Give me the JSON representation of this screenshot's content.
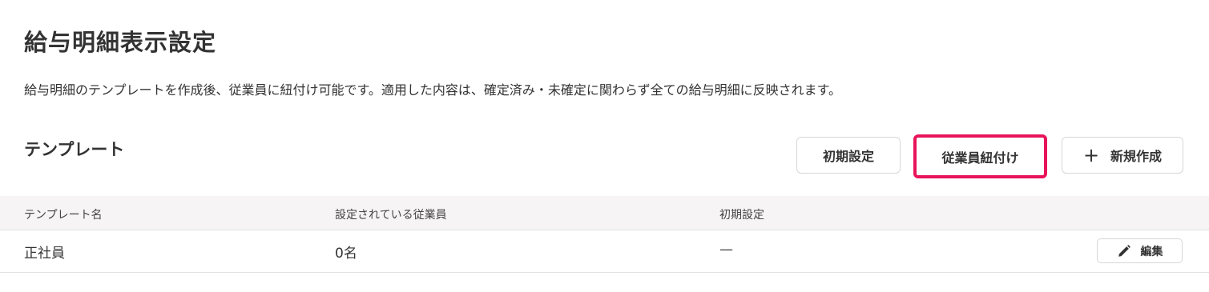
{
  "page": {
    "title": "給与明細表示設定",
    "description": "給与明細のテンプレートを作成後、従業員に紐付け可能です。適用した内容は、確定済み・未確定に関わらず全ての給与明細に反映されます。"
  },
  "section": {
    "title": "テンプレート"
  },
  "toolbar": {
    "initial_settings_label": "初期設定",
    "link_employees_label": "従業員紐付け",
    "new_create_label": "新規作成",
    "plus_glyph": "+",
    "highlight_color": "#e8145a"
  },
  "table": {
    "headers": [
      "テンプレート名",
      "設定されている従業員",
      "初期設定"
    ],
    "rows": [
      {
        "name": "正社員",
        "employees": "0名",
        "initial": "—",
        "edit_label": "編集",
        "edit_icon": "pencil-icon"
      }
    ]
  }
}
